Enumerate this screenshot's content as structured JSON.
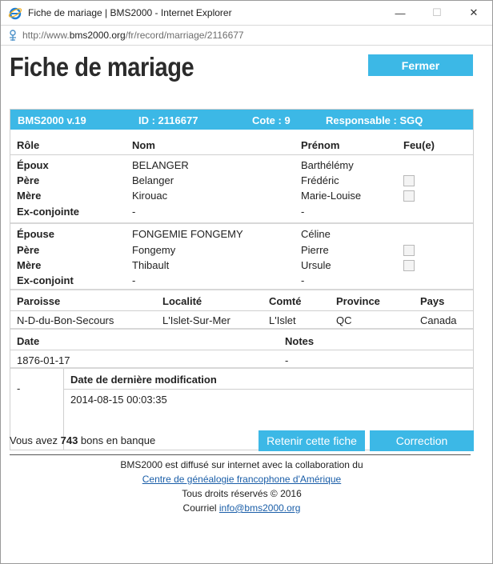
{
  "window": {
    "title": "Fiche de mariage | BMS2000 - Internet Explorer",
    "url_prefix": "http://www.",
    "url_domain": "bms2000.org",
    "url_path": "/fr/record/marriage/2116677"
  },
  "page": {
    "title": "Fiche de mariage",
    "close_label": "Fermer"
  },
  "record_header": {
    "version": "BMS2000 v.19",
    "id": "ID : 2116677",
    "cote": "Cote : 9",
    "responsable": "Responsable : SGQ"
  },
  "columns": {
    "role": "Rôle",
    "name": "Nom",
    "first_name": "Prénom",
    "deceased": "Feu(e)"
  },
  "groom_group": [
    {
      "role": "Époux",
      "name": "BELANGER",
      "first_name": "Barthélémy",
      "deceased": null
    },
    {
      "role": "Père",
      "name": "Belanger",
      "first_name": "Frédéric",
      "deceased": false
    },
    {
      "role": "Mère",
      "name": "Kirouac",
      "first_name": "Marie-Louise",
      "deceased": false
    },
    {
      "role": "Ex-conjointe",
      "name": "-",
      "first_name": "-",
      "deceased": null
    }
  ],
  "bride_group": [
    {
      "role": "Épouse",
      "name": "FONGEMIE FONGEMY",
      "first_name": "Céline",
      "deceased": null
    },
    {
      "role": "Père",
      "name": "Fongemy",
      "first_name": "Pierre",
      "deceased": false
    },
    {
      "role": "Mère",
      "name": "Thibault",
      "first_name": "Ursule",
      "deceased": false
    },
    {
      "role": "Ex-conjoint",
      "name": "-",
      "first_name": "-",
      "deceased": null
    }
  ],
  "location": {
    "headers": {
      "parish": "Paroisse",
      "locality": "Localité",
      "county": "Comté",
      "province": "Province",
      "country": "Pays"
    },
    "values": {
      "parish": "N-D-du-Bon-Secours",
      "locality": "L'Islet-Sur-Mer",
      "county": "L'Islet",
      "province": "QC",
      "country": "Canada"
    }
  },
  "event": {
    "headers": {
      "date": "Date",
      "notes": "Notes"
    },
    "values": {
      "date": "1876-01-17",
      "notes": "-"
    }
  },
  "modification": {
    "left_value": "-",
    "header": "Date de dernière modification",
    "value": "2014-08-15 00:03:35"
  },
  "bank": {
    "prefix": "Vous avez ",
    "count": "743",
    "suffix": " bons en banque"
  },
  "actions": {
    "keep_label": "Retenir cette fiche",
    "correction_label": "Correction"
  },
  "footer": {
    "line1": "BMS2000 est diffusé sur internet avec la collaboration du",
    "link": "Centre de généalogie francophone d'Amérique",
    "rights": "Tous droits réservés © 2016",
    "email_label": "Courriel ",
    "email": "info@bms2000.org"
  },
  "colors": {
    "accent": "#3cb8e6",
    "link": "#1a5ea8"
  }
}
